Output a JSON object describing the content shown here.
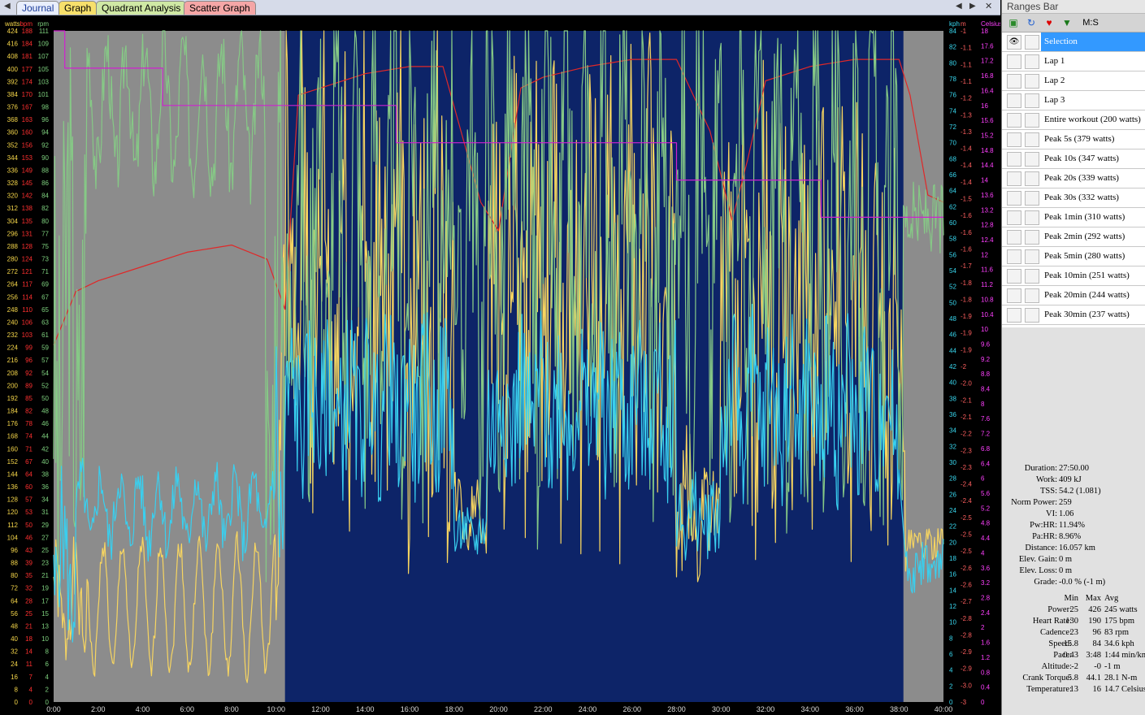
{
  "tabs": [
    {
      "label": "Journal"
    },
    {
      "label": "Graph"
    },
    {
      "label": "Quadrant Analysis"
    },
    {
      "label": "Scatter Graph"
    }
  ],
  "axes": {
    "left": [
      {
        "unit": "watts",
        "color": "#f5d64a",
        "min": 0,
        "max": 424
      },
      {
        "unit": "bpm",
        "color": "#ff3030",
        "min": 0,
        "max": 188
      },
      {
        "unit": "rpm",
        "color": "#7ed07e",
        "min": 0,
        "max": 111
      }
    ],
    "right": [
      {
        "unit": "kph",
        "color": "#38d8f0",
        "min": 0,
        "max": 84
      },
      {
        "unit": "m",
        "color": "#ff6060",
        "min": -3,
        "max": -1
      },
      {
        "unit": "Celsius",
        "color": "#ff40ff",
        "min": 0,
        "max": 18
      }
    ],
    "x": {
      "min_minutes": 0,
      "max_minutes": 40,
      "labels": [
        "0:00",
        "2:00",
        "4:00",
        "6:00",
        "8:00",
        "10:00",
        "12:00",
        "14:00",
        "16:00",
        "18:00",
        "20:00",
        "22:00",
        "24:00",
        "26:00",
        "28:00",
        "30:00",
        "32:00",
        "34:00",
        "36:00",
        "38:00",
        "40:00"
      ]
    }
  },
  "chart_data": {
    "type": "line",
    "x_unit": "minutes",
    "selection_minutes": [
      10.4,
      38.2
    ],
    "series": [
      {
        "name": "Power",
        "unit": "watts",
        "color": "#f7d560",
        "axis": "watts",
        "seed": 1,
        "segments": [
          [
            0,
            1.5,
            40,
            80,
            25
          ],
          [
            1.5,
            10,
            100,
            20,
            8
          ],
          [
            10,
            10.4,
            60,
            300,
            40
          ],
          [
            10.4,
            18,
            190,
            330,
            120
          ],
          [
            18,
            19.5,
            110,
            130,
            20
          ],
          [
            19.5,
            28,
            190,
            320,
            110
          ],
          [
            28,
            30,
            100,
            140,
            40
          ],
          [
            30,
            38,
            180,
            310,
            100
          ],
          [
            38,
            38.3,
            80,
            250,
            60
          ],
          [
            38.3,
            40,
            100,
            100,
            10
          ]
        ]
      },
      {
        "name": "Heart Rate",
        "unit": "bpm",
        "color": "#e02828",
        "axis": "bpm",
        "points": [
          [
            0,
            100
          ],
          [
            1,
            115
          ],
          [
            2,
            118
          ],
          [
            4,
            122
          ],
          [
            6,
            126
          ],
          [
            8,
            128
          ],
          [
            9.6,
            124
          ],
          [
            10.4,
            110
          ],
          [
            11,
            170
          ],
          [
            12,
            172
          ],
          [
            14,
            176
          ],
          [
            16,
            178
          ],
          [
            17.5,
            178
          ],
          [
            19.2,
            140
          ],
          [
            20,
            132
          ],
          [
            21,
            172
          ],
          [
            22,
            175
          ],
          [
            24,
            178
          ],
          [
            26,
            180
          ],
          [
            28,
            180
          ],
          [
            29.5,
            160
          ],
          [
            30.5,
            135
          ],
          [
            31.2,
            152
          ],
          [
            32,
            174
          ],
          [
            34,
            178
          ],
          [
            36,
            180
          ],
          [
            38,
            180
          ],
          [
            38.5,
            170
          ],
          [
            39.3,
            142
          ],
          [
            40,
            140
          ]
        ]
      },
      {
        "name": "Cadence",
        "unit": "rpm",
        "color": "#86c986",
        "axis": "rpm",
        "seed": 3,
        "segments": [
          [
            0,
            1.5,
            40,
            80,
            40
          ],
          [
            1.5,
            9.5,
            88,
            108,
            6
          ],
          [
            9.5,
            10.4,
            30,
            90,
            30
          ],
          [
            10.4,
            38.2,
            55,
            100,
            30
          ],
          [
            38.2,
            40,
            80,
            80,
            6
          ]
        ]
      },
      {
        "name": "Speed",
        "unit": "kph",
        "color": "#38d0f0",
        "axis": "kph",
        "seed": 5,
        "segments": [
          [
            0,
            1,
            12,
            22,
            8
          ],
          [
            1,
            10,
            20,
            28,
            3
          ],
          [
            10,
            10.4,
            20,
            40,
            15
          ],
          [
            10.4,
            18,
            34,
            40,
            10
          ],
          [
            18,
            19.5,
            20,
            22,
            3
          ],
          [
            19.5,
            28,
            34,
            40,
            10
          ],
          [
            28,
            30,
            22,
            24,
            5
          ],
          [
            30,
            38,
            34,
            40,
            10
          ],
          [
            38.2,
            40,
            16,
            18,
            3
          ]
        ]
      },
      {
        "name": "Temperature",
        "unit": "Celsius",
        "color": "#d020d0",
        "axis": "Celsius",
        "step": true,
        "points": [
          [
            0,
            18
          ],
          [
            0.5,
            18
          ],
          [
            0.5,
            17
          ],
          [
            4.9,
            17
          ],
          [
            4.9,
            16
          ],
          [
            15.4,
            16
          ],
          [
            15.4,
            15
          ],
          [
            28,
            15
          ],
          [
            28,
            14
          ],
          [
            34.5,
            14
          ],
          [
            34.5,
            13
          ],
          [
            40,
            13
          ]
        ]
      }
    ]
  },
  "ranges_bar": {
    "title": "Ranges Bar",
    "toolbar_label": "M:S",
    "items": [
      {
        "label": "Selection",
        "selected": true
      },
      {
        "label": "Lap 1"
      },
      {
        "label": "Lap 2"
      },
      {
        "label": "Lap 3"
      },
      {
        "label": "Entire workout (200 watts)"
      },
      {
        "label": "Peak 5s (379 watts)"
      },
      {
        "label": "Peak 10s (347 watts)"
      },
      {
        "label": "Peak 20s (339 watts)"
      },
      {
        "label": "Peak 30s (332 watts)"
      },
      {
        "label": "Peak 1min (310 watts)"
      },
      {
        "label": "Peak 2min (292 watts)"
      },
      {
        "label": "Peak 5min (280 watts)"
      },
      {
        "label": "Peak 10min (251 watts)"
      },
      {
        "label": "Peak 20min (244 watts)"
      },
      {
        "label": "Peak 30min (237 watts)"
      }
    ]
  },
  "stats": [
    {
      "k": "Duration:",
      "v": "27:50.00"
    },
    {
      "k": "Work:",
      "v": "409 kJ"
    },
    {
      "k": "TSS:",
      "v": "54.2 (1.081)"
    },
    {
      "k": "Norm Power:",
      "v": "259"
    },
    {
      "k": "VI:",
      "v": "1.06"
    },
    {
      "k": "Pw:HR:",
      "v": "11.94%"
    },
    {
      "k": "Pa:HR:",
      "v": "8.96%"
    },
    {
      "k": "Distance:",
      "v": "16.057 km"
    },
    {
      "k": "Elev. Gain:",
      "v": "0 m"
    },
    {
      "k": "Elev. Loss:",
      "v": "0 m"
    },
    {
      "k": "Grade:",
      "v": "-0.0 %  (-1 m)"
    }
  ],
  "table": {
    "header": [
      "",
      "Min",
      "Max",
      "Avg"
    ],
    "rows": [
      [
        "Power:",
        "25",
        "426",
        "245 watts"
      ],
      [
        "Heart Rate:",
        "130",
        "190",
        "175 bpm"
      ],
      [
        "Cadence:",
        "23",
        "96",
        "83 rpm"
      ],
      [
        "Speed:",
        "15.8",
        "84",
        "34.6 kph"
      ],
      [
        "Pace:",
        "0:43",
        "3:48",
        "1:44 min/km"
      ],
      [
        "Altitude:",
        "-2",
        "-0",
        "-1 m"
      ],
      [
        "Crank Torque:",
        "5.8",
        "44.1",
        "28.1 N-m"
      ],
      [
        "Temperature:",
        "13",
        "16",
        "14.7 Celsius"
      ]
    ]
  }
}
